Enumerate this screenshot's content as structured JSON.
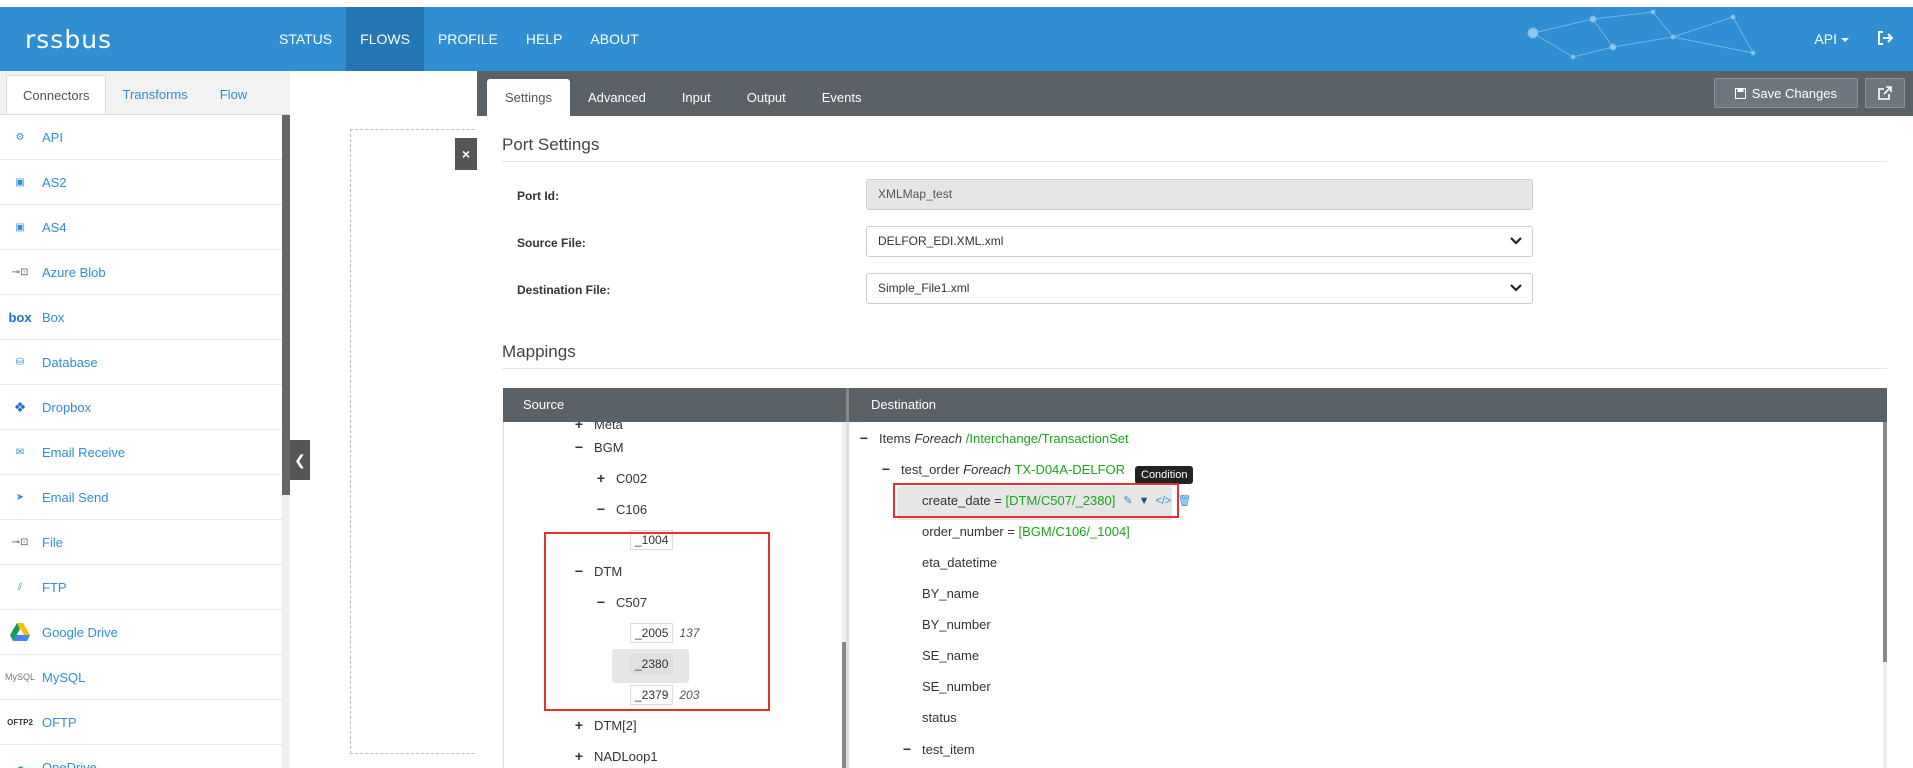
{
  "app": {
    "logo": "rssbus"
  },
  "nav": {
    "items": [
      "STATUS",
      "FLOWS",
      "PROFILE",
      "HELP",
      "ABOUT"
    ],
    "active": "FLOWS",
    "api_label": "API"
  },
  "sidebar": {
    "tabs": [
      "Connectors",
      "Transforms",
      "Flow"
    ],
    "active_tab": "Connectors",
    "connectors": [
      {
        "label": "API",
        "icon": "gear-icon"
      },
      {
        "label": "AS2",
        "icon": "as2-icon"
      },
      {
        "label": "AS4",
        "icon": "as4-icon"
      },
      {
        "label": "Azure Blob",
        "icon": "plug-icon"
      },
      {
        "label": "Box",
        "icon": "box-icon"
      },
      {
        "label": "Database",
        "icon": "database-icon"
      },
      {
        "label": "Dropbox",
        "icon": "dropbox-icon"
      },
      {
        "label": "Email Receive",
        "icon": "email-receive-icon"
      },
      {
        "label": "Email Send",
        "icon": "paper-plane-icon"
      },
      {
        "label": "File",
        "icon": "plug-icon"
      },
      {
        "label": "FTP",
        "icon": "ftp-icon"
      },
      {
        "label": "Google Drive",
        "icon": "google-drive-icon"
      },
      {
        "label": "MySQL",
        "icon": "mysql-icon"
      },
      {
        "label": "OFTP",
        "icon": "oftp-icon"
      },
      {
        "label": "OneDrive",
        "icon": "onedrive-icon"
      }
    ]
  },
  "panel": {
    "tabs": [
      "Settings",
      "Advanced",
      "Input",
      "Output",
      "Events"
    ],
    "active_tab": "Settings",
    "save_label": "Save Changes",
    "port_settings_title": "Port Settings",
    "port_id_label": "Port Id:",
    "port_id_value": "XMLMap_test",
    "source_file_label": "Source File:",
    "source_file_value": "DELFOR_EDI.XML.xml",
    "dest_file_label": "Destination File:",
    "dest_file_value": "Simple_File1.xml",
    "mappings_title": "Mappings"
  },
  "mappings": {
    "source_header": "Source",
    "destination_header": "Destination",
    "source_tree": {
      "meta": "Meta",
      "bgm": "BGM",
      "c002": "C002",
      "c106": "C106",
      "leaf_1004": "_1004",
      "dtm": "DTM",
      "c507": "C507",
      "leaf_2005": "_2005",
      "note_2005": "137",
      "leaf_2380": "_2380",
      "leaf_2379": "_2379",
      "note_2379": "203",
      "dtm2": "DTM[2]",
      "nadloop1": "NADLoop1"
    },
    "dest_tree": {
      "items": "Items",
      "foreach1": "Foreach",
      "items_path": "/Interchange/TransactionSet",
      "test_order": "test_order",
      "foreach2": "Foreach",
      "test_order_path": "TX-D04A-DELFOR",
      "create_date": "create_date =",
      "create_date_val": "[DTM/C507/_2380]",
      "order_number": "order_number =",
      "order_number_val": "[BGM/C106/_1004]",
      "eta_datetime": "eta_datetime",
      "by_name": "BY_name",
      "by_number": "BY_number",
      "se_name": "SE_name",
      "se_number": "SE_number",
      "status": "status",
      "test_item": "test_item"
    },
    "tooltip": "Condition"
  }
}
